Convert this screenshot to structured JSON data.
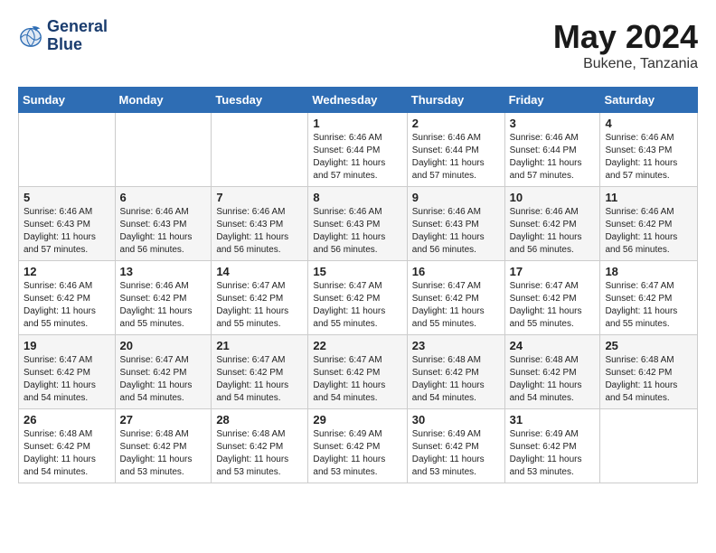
{
  "app": {
    "name": "GeneralBlue",
    "logo_line1": "General",
    "logo_line2": "Blue"
  },
  "title": {
    "month_year": "May 2024",
    "location": "Bukene, Tanzania"
  },
  "weekdays": [
    "Sunday",
    "Monday",
    "Tuesday",
    "Wednesday",
    "Thursday",
    "Friday",
    "Saturday"
  ],
  "weeks": [
    [
      {
        "day": "",
        "info": ""
      },
      {
        "day": "",
        "info": ""
      },
      {
        "day": "",
        "info": ""
      },
      {
        "day": "1",
        "info": "Sunrise: 6:46 AM\nSunset: 6:44 PM\nDaylight: 11 hours\nand 57 minutes."
      },
      {
        "day": "2",
        "info": "Sunrise: 6:46 AM\nSunset: 6:44 PM\nDaylight: 11 hours\nand 57 minutes."
      },
      {
        "day": "3",
        "info": "Sunrise: 6:46 AM\nSunset: 6:44 PM\nDaylight: 11 hours\nand 57 minutes."
      },
      {
        "day": "4",
        "info": "Sunrise: 6:46 AM\nSunset: 6:43 PM\nDaylight: 11 hours\nand 57 minutes."
      }
    ],
    [
      {
        "day": "5",
        "info": "Sunrise: 6:46 AM\nSunset: 6:43 PM\nDaylight: 11 hours\nand 57 minutes."
      },
      {
        "day": "6",
        "info": "Sunrise: 6:46 AM\nSunset: 6:43 PM\nDaylight: 11 hours\nand 56 minutes."
      },
      {
        "day": "7",
        "info": "Sunrise: 6:46 AM\nSunset: 6:43 PM\nDaylight: 11 hours\nand 56 minutes."
      },
      {
        "day": "8",
        "info": "Sunrise: 6:46 AM\nSunset: 6:43 PM\nDaylight: 11 hours\nand 56 minutes."
      },
      {
        "day": "9",
        "info": "Sunrise: 6:46 AM\nSunset: 6:43 PM\nDaylight: 11 hours\nand 56 minutes."
      },
      {
        "day": "10",
        "info": "Sunrise: 6:46 AM\nSunset: 6:42 PM\nDaylight: 11 hours\nand 56 minutes."
      },
      {
        "day": "11",
        "info": "Sunrise: 6:46 AM\nSunset: 6:42 PM\nDaylight: 11 hours\nand 56 minutes."
      }
    ],
    [
      {
        "day": "12",
        "info": "Sunrise: 6:46 AM\nSunset: 6:42 PM\nDaylight: 11 hours\nand 55 minutes."
      },
      {
        "day": "13",
        "info": "Sunrise: 6:46 AM\nSunset: 6:42 PM\nDaylight: 11 hours\nand 55 minutes."
      },
      {
        "day": "14",
        "info": "Sunrise: 6:47 AM\nSunset: 6:42 PM\nDaylight: 11 hours\nand 55 minutes."
      },
      {
        "day": "15",
        "info": "Sunrise: 6:47 AM\nSunset: 6:42 PM\nDaylight: 11 hours\nand 55 minutes."
      },
      {
        "day": "16",
        "info": "Sunrise: 6:47 AM\nSunset: 6:42 PM\nDaylight: 11 hours\nand 55 minutes."
      },
      {
        "day": "17",
        "info": "Sunrise: 6:47 AM\nSunset: 6:42 PM\nDaylight: 11 hours\nand 55 minutes."
      },
      {
        "day": "18",
        "info": "Sunrise: 6:47 AM\nSunset: 6:42 PM\nDaylight: 11 hours\nand 55 minutes."
      }
    ],
    [
      {
        "day": "19",
        "info": "Sunrise: 6:47 AM\nSunset: 6:42 PM\nDaylight: 11 hours\nand 54 minutes."
      },
      {
        "day": "20",
        "info": "Sunrise: 6:47 AM\nSunset: 6:42 PM\nDaylight: 11 hours\nand 54 minutes."
      },
      {
        "day": "21",
        "info": "Sunrise: 6:47 AM\nSunset: 6:42 PM\nDaylight: 11 hours\nand 54 minutes."
      },
      {
        "day": "22",
        "info": "Sunrise: 6:47 AM\nSunset: 6:42 PM\nDaylight: 11 hours\nand 54 minutes."
      },
      {
        "day": "23",
        "info": "Sunrise: 6:48 AM\nSunset: 6:42 PM\nDaylight: 11 hours\nand 54 minutes."
      },
      {
        "day": "24",
        "info": "Sunrise: 6:48 AM\nSunset: 6:42 PM\nDaylight: 11 hours\nand 54 minutes."
      },
      {
        "day": "25",
        "info": "Sunrise: 6:48 AM\nSunset: 6:42 PM\nDaylight: 11 hours\nand 54 minutes."
      }
    ],
    [
      {
        "day": "26",
        "info": "Sunrise: 6:48 AM\nSunset: 6:42 PM\nDaylight: 11 hours\nand 54 minutes."
      },
      {
        "day": "27",
        "info": "Sunrise: 6:48 AM\nSunset: 6:42 PM\nDaylight: 11 hours\nand 53 minutes."
      },
      {
        "day": "28",
        "info": "Sunrise: 6:48 AM\nSunset: 6:42 PM\nDaylight: 11 hours\nand 53 minutes."
      },
      {
        "day": "29",
        "info": "Sunrise: 6:49 AM\nSunset: 6:42 PM\nDaylight: 11 hours\nand 53 minutes."
      },
      {
        "day": "30",
        "info": "Sunrise: 6:49 AM\nSunset: 6:42 PM\nDaylight: 11 hours\nand 53 minutes."
      },
      {
        "day": "31",
        "info": "Sunrise: 6:49 AM\nSunset: 6:42 PM\nDaylight: 11 hours\nand 53 minutes."
      },
      {
        "day": "",
        "info": ""
      }
    ]
  ]
}
